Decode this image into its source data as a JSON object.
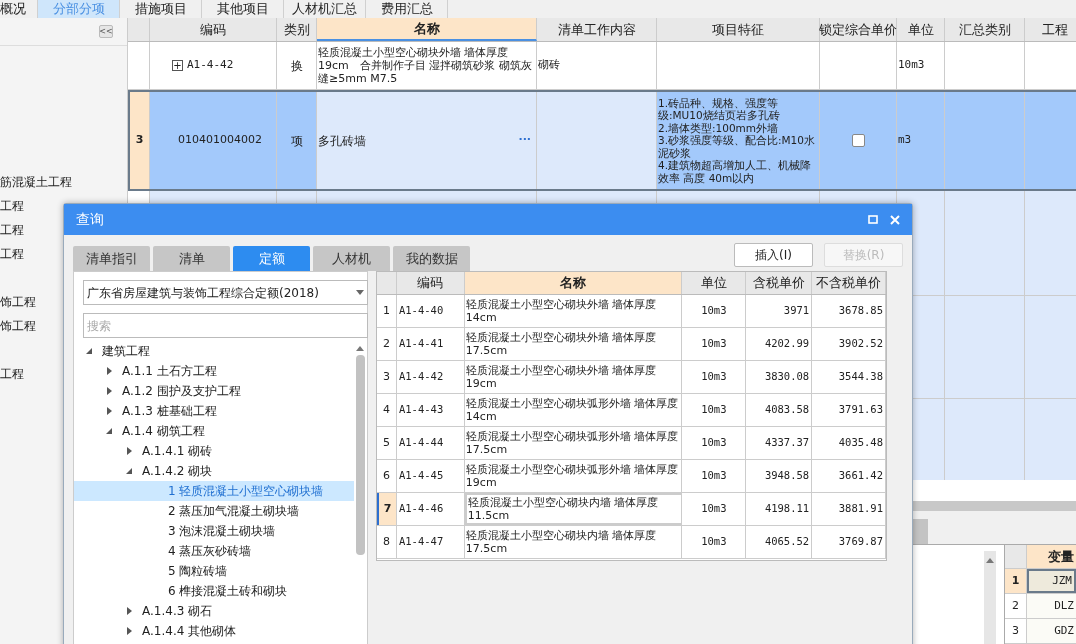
{
  "top_tabs": [
    {
      "label": "概况",
      "selected": false
    },
    {
      "label": "分部分项",
      "selected": true
    },
    {
      "label": "措施项目",
      "selected": false
    },
    {
      "label": "其他项目",
      "selected": false
    },
    {
      "label": "人材机汇总",
      "selected": false
    },
    {
      "label": "费用汇总",
      "selected": false
    }
  ],
  "side_panel": {
    "collapse_button": "<<",
    "items": [
      {
        "text": "筋混凝土工程"
      },
      {
        "text": "工程"
      },
      {
        "text": "工程"
      },
      {
        "text": "工程"
      },
      {
        "text": "饰工程"
      },
      {
        "text": "饰工程"
      },
      {
        "text": "工程"
      }
    ]
  },
  "main_grid": {
    "columns": [
      "编码",
      "类别",
      "名称",
      "清单工作内容",
      "项目特征",
      "锁定综合单价",
      "单位",
      "汇总类别",
      "工程"
    ],
    "rows": [
      {
        "kind": "quota",
        "number": "",
        "code": "A1-4-42",
        "expander": "+",
        "type": "换",
        "name": "轻质混凝土小型空心砌块外墙 墙体厚度19cm　合并制作子目 湿拌砌筑砂浆 砌筑灰缝≥5mm M7.5",
        "work": "砌砖",
        "features": "",
        "unit": "10m3",
        "selected": false
      },
      {
        "kind": "item",
        "number": "3",
        "code": "010401004002",
        "type": "项",
        "name": "多孔砖墙",
        "more": "···",
        "work": "",
        "features": "1.砖品种、规格、强度等级:MU10烧结页岩多孔砖\n2.墙体类型:100mm外墙\n3.砂浆强度等级、配合比:M10水泥砂浆\n4.建筑物超高增加人工、机械降效率 高度 40m以内",
        "locked": false,
        "unit": "m3",
        "selected": true
      }
    ]
  },
  "bottom_panel": {
    "table": {
      "column": "变量",
      "rows": [
        {
          "number": "1",
          "value": "JZM",
          "selected": true
        },
        {
          "number": "2",
          "value": "DLZ",
          "selected": false
        },
        {
          "number": "3",
          "value": "GDZ",
          "selected": false
        }
      ]
    }
  },
  "dialog": {
    "title": "查询",
    "tabs": [
      {
        "label": "清单指引",
        "selected": false
      },
      {
        "label": "清单",
        "selected": false
      },
      {
        "label": "定额",
        "selected": true
      },
      {
        "label": "人材机",
        "selected": false
      },
      {
        "label": "我的数据",
        "selected": false
      }
    ],
    "buttons": [
      {
        "label": "插入(I)",
        "disabled": false
      },
      {
        "label": "替换(R)",
        "disabled": true
      }
    ],
    "library": "广东省房屋建筑与装饰工程综合定额(2018)",
    "search": {
      "placeholder": "搜索"
    },
    "tree": [
      {
        "label": "建筑工程",
        "expanded": true,
        "selected": false,
        "children": [
          {
            "label": "A.1.1 土石方工程",
            "expanded": false,
            "selected": false
          },
          {
            "label": "A.1.2 围护及支护工程",
            "expanded": false,
            "selected": false
          },
          {
            "label": "A.1.3 桩基础工程",
            "expanded": false,
            "selected": false
          },
          {
            "label": "A.1.4 砌筑工程",
            "expanded": true,
            "selected": false,
            "children": [
              {
                "label": "A.1.4.1 砌砖",
                "expanded": false,
                "selected": false
              },
              {
                "label": "A.1.4.2 砌块",
                "expanded": true,
                "selected": false,
                "children": [
                  {
                    "label": "1 轻质混凝土小型空心砌块墙",
                    "selected": true
                  },
                  {
                    "label": "2 蒸压加气混凝土砌块墙",
                    "selected": false
                  },
                  {
                    "label": "3 泡沫混凝土砌块墙",
                    "selected": false
                  },
                  {
                    "label": "4 蒸压灰砂砖墙",
                    "selected": false
                  },
                  {
                    "label": "5 陶粒砖墙",
                    "selected": false
                  },
                  {
                    "label": "6 榫接混凝土砖和砌块",
                    "selected": false
                  }
                ]
              },
              {
                "label": "A.1.4.3 砌石",
                "expanded": false,
                "selected": false
              },
              {
                "label": "A.1.4.4 其他砌体",
                "expanded": false,
                "selected": false
              }
            ]
          }
        ]
      }
    ],
    "grid": {
      "columns": [
        "编码",
        "名称",
        "单位",
        "含税单价",
        "不含税单价"
      ],
      "rows": [
        {
          "number": "1",
          "code": "A1-4-40",
          "name": "轻质混凝土小型空心砌块外墙 墙体厚度 14cm",
          "unit": "10m3",
          "price_tax": "3971",
          "price_notax": "3678.85",
          "selected": false
        },
        {
          "number": "2",
          "code": "A1-4-41",
          "name": "轻质混凝土小型空心砌块外墙 墙体厚度 17.5cm",
          "unit": "10m3",
          "price_tax": "4202.99",
          "price_notax": "3902.52",
          "selected": false
        },
        {
          "number": "3",
          "code": "A1-4-42",
          "name": "轻质混凝土小型空心砌块外墙 墙体厚度 19cm",
          "unit": "10m3",
          "price_tax": "3830.08",
          "price_notax": "3544.38",
          "selected": false
        },
        {
          "number": "4",
          "code": "A1-4-43",
          "name": "轻质混凝土小型空心砌块弧形外墙 墙体厚度 14cm",
          "unit": "10m3",
          "price_tax": "4083.58",
          "price_notax": "3791.63",
          "selected": false
        },
        {
          "number": "5",
          "code": "A1-4-44",
          "name": "轻质混凝土小型空心砌块弧形外墙 墙体厚度 17.5cm",
          "unit": "10m3",
          "price_tax": "4337.37",
          "price_notax": "4035.48",
          "selected": false
        },
        {
          "number": "6",
          "code": "A1-4-45",
          "name": "轻质混凝土小型空心砌块弧形外墙 墙体厚度 19cm",
          "unit": "10m3",
          "price_tax": "3948.58",
          "price_notax": "3661.42",
          "selected": false
        },
        {
          "number": "7",
          "code": "A1-4-46",
          "name": "轻质混凝土小型空心砌块内墙 墙体厚度 11.5cm",
          "unit": "10m3",
          "price_tax": "4198.11",
          "price_notax": "3881.91",
          "selected": true
        },
        {
          "number": "8",
          "code": "A1-4-47",
          "name": "轻质混凝土小型空心砌块内墙 墙体厚度 17.5cm",
          "unit": "10m3",
          "price_tax": "4065.52",
          "price_notax": "3769.87",
          "selected": false
        }
      ]
    }
  }
}
